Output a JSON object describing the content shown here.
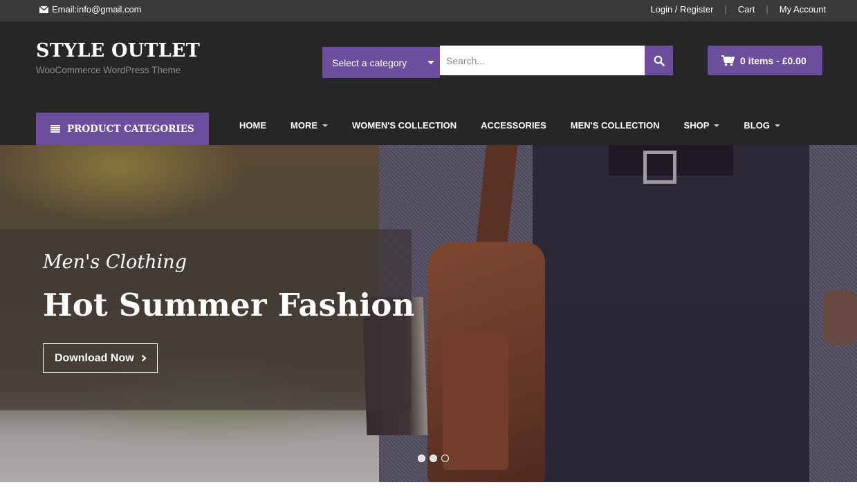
{
  "topbar": {
    "email": "Email:info@gmail.com",
    "links": [
      "Login / Register",
      "Cart",
      "My Account"
    ]
  },
  "header": {
    "site_title": "STYLE OUTLET",
    "tagline": "WooCommerce WordPress Theme",
    "category_select": "Select a category",
    "search_placeholder": "Search...",
    "cart_label": "0 items - £0.00"
  },
  "menu": {
    "product_categories": "PRODUCT CATEGORIES",
    "items": [
      {
        "label": "HOME",
        "dropdown": false
      },
      {
        "label": "MORE",
        "dropdown": true
      },
      {
        "label": "WOMEN'S COLLECTION",
        "dropdown": false
      },
      {
        "label": "ACCESSORIES",
        "dropdown": false
      },
      {
        "label": "MEN'S COLLECTION",
        "dropdown": false
      },
      {
        "label": "SHOP",
        "dropdown": true
      },
      {
        "label": "BLOG",
        "dropdown": true
      }
    ]
  },
  "hero": {
    "subtitle": "Men's Clothing",
    "title": "Hot Summer Fashion",
    "button": "Download Now",
    "slides": 3,
    "active_slide": 3
  },
  "colors": {
    "accent": "#6d4e9e",
    "header_bg": "#262626",
    "topbar_bg": "#3a3a3a"
  }
}
